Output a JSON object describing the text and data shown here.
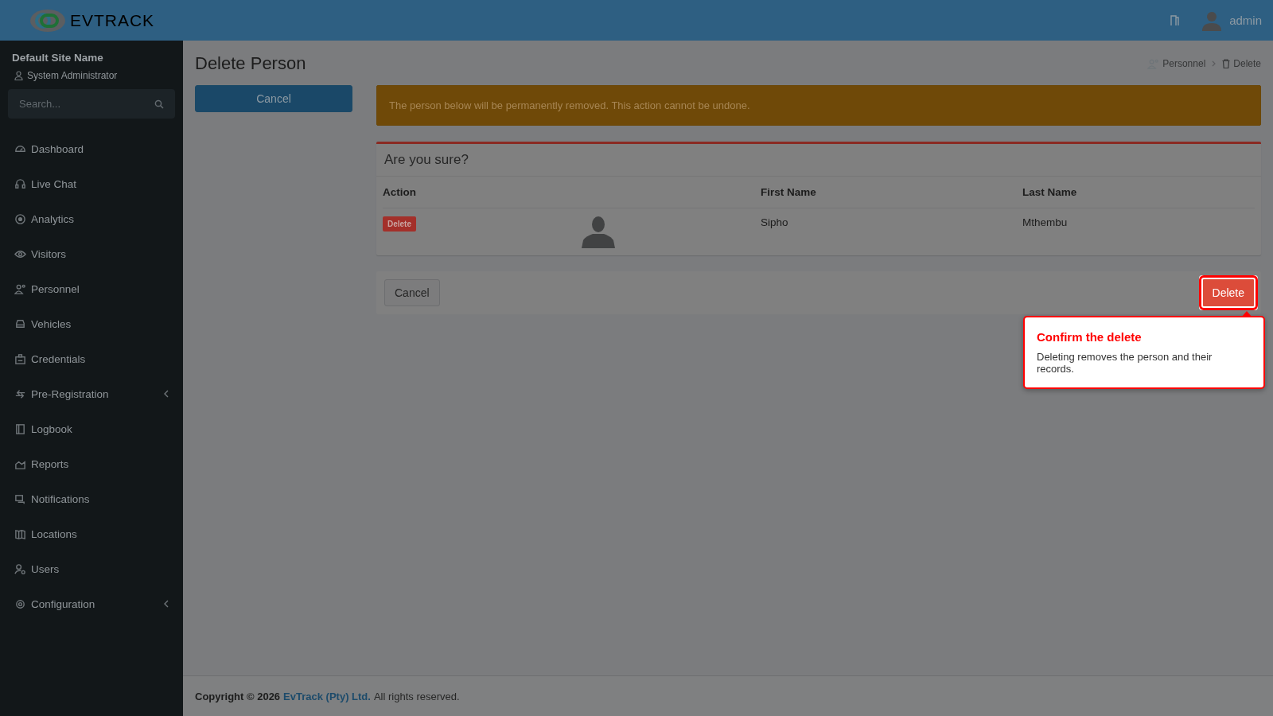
{
  "header": {
    "logo": "**EV**TRACK",
    "user": "admin"
  },
  "sidebar": {
    "site": "Default Site Name",
    "role": "System Administrator",
    "search": {
      "placeholder": "Search..."
    },
    "items": [
      {
        "label": "Dashboard",
        "submenu": false
      },
      {
        "label": "Live Chat",
        "submenu": false
      },
      {
        "label": "Analytics",
        "submenu": false
      },
      {
        "label": "Visitors",
        "submenu": false
      },
      {
        "label": "Personnel",
        "submenu": false
      },
      {
        "label": "Vehicles",
        "submenu": false
      },
      {
        "label": "Credentials",
        "submenu": false
      },
      {
        "label": "Pre-Registration",
        "submenu": true
      },
      {
        "label": "Logbook",
        "submenu": false
      },
      {
        "label": "Reports",
        "submenu": false
      },
      {
        "label": "Notifications",
        "submenu": false
      },
      {
        "label": "Locations",
        "submenu": false
      },
      {
        "label": "Users",
        "submenu": false
      },
      {
        "label": "Configuration",
        "submenu": true
      }
    ]
  },
  "page": {
    "title": "Delete Person",
    "cancel_button": "Cancel",
    "breadcrumb": [
      "Personnel",
      "Delete"
    ]
  },
  "alert": "The person below will be permanently removed. This action cannot be undone.",
  "card": {
    "title": "Are you sure?",
    "columns": [
      {
        "label": "Action"
      },
      {
        "label": "First Name"
      },
      {
        "label": "Last Name"
      }
    ],
    "rows": [
      {
        "action": "Delete",
        "first_name": "Sipho",
        "last_name": "Mthembu"
      }
    ]
  },
  "actions": {
    "cancel": "Cancel",
    "delete": "Delete"
  },
  "tooltip": {
    "title": "Confirm the delete",
    "text": "Deleting removes the person and their records."
  },
  "footer": {
    "prefix": "Copyright © 2026",
    "link": "EvTrack (Pty) Ltd.",
    "suffix": "All rights reserved."
  }
}
